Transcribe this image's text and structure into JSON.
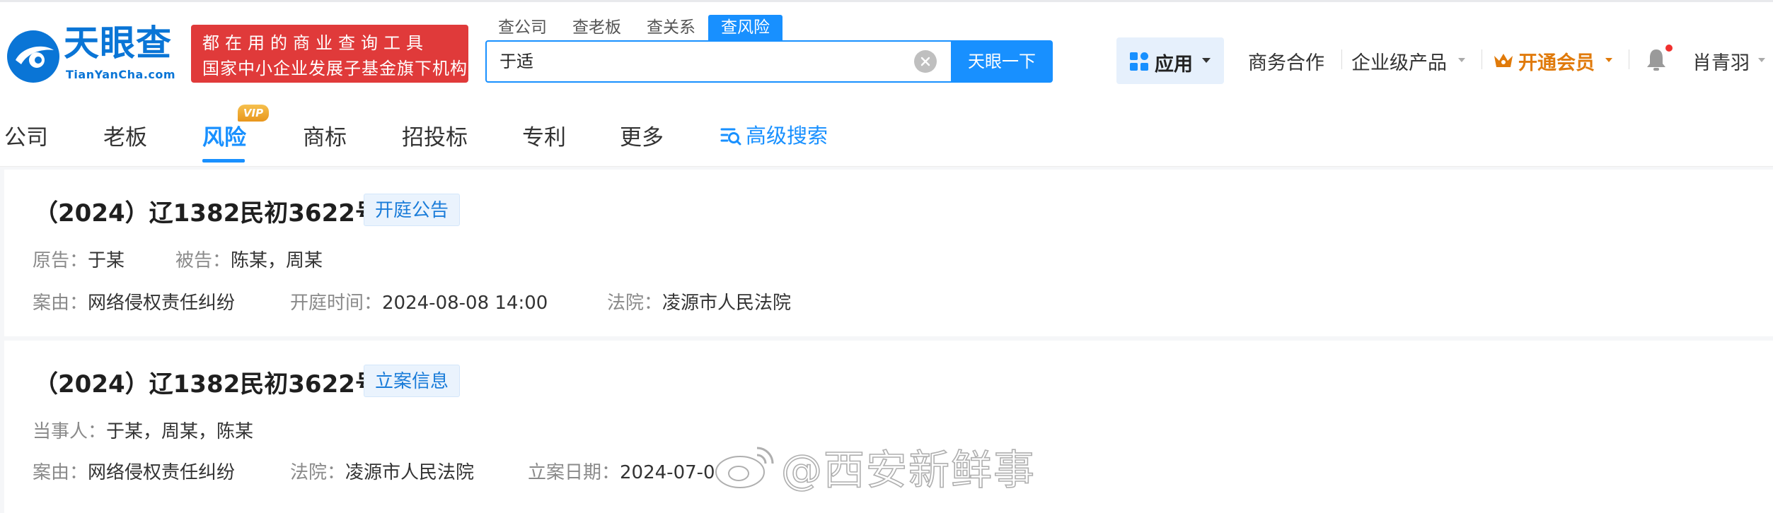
{
  "logo": {
    "cn": "天眼查",
    "en": "TianYanCha.com"
  },
  "slogan": {
    "line1": "都在用的商业查询工具",
    "line2": "国家中小企业发展子基金旗下机构"
  },
  "search": {
    "tabs": [
      "查公司",
      "查老板",
      "查关系",
      "查风险"
    ],
    "active_tab": "查风险",
    "query": "于适",
    "button": "天眼一下"
  },
  "nav": {
    "apps": "应用",
    "business": "商务合作",
    "enterprise": "企业级产品",
    "vip": "开通会员",
    "user": "肖青羽"
  },
  "categories": {
    "items": [
      "公司",
      "老板",
      "风险",
      "商标",
      "招投标",
      "专利",
      "更多"
    ],
    "active": "风险",
    "vip_badge": "VIP",
    "advanced": "高级搜索"
  },
  "cards": [
    {
      "title": "（2024）辽1382民初3622号",
      "tag": "开庭公告",
      "row1": [
        {
          "k": "原告：",
          "v": "于某"
        },
        {
          "k": "被告：",
          "v": "陈某，周某"
        }
      ],
      "row2": [
        {
          "k": "案由：",
          "v": "网络侵权责任纠纷"
        },
        {
          "k": "开庭时间：",
          "v": "2024-08-08 14:00"
        },
        {
          "k": "法院：",
          "v": "凌源市人民法院"
        }
      ]
    },
    {
      "title": "（2024）辽1382民初3622号",
      "tag": "立案信息",
      "row1": [
        {
          "k": "当事人：",
          "v": "于某，周某，陈某"
        }
      ],
      "row2": [
        {
          "k": "案由：",
          "v": "网络侵权责任纠纷"
        },
        {
          "k": "法院：",
          "v": "凌源市人民法院"
        },
        {
          "k": "立案日期：",
          "v": "2024-07-0"
        }
      ]
    }
  ],
  "watermark": "@西安新鲜事",
  "colors": {
    "brand": "#1890ff",
    "logo": "#0a75d6",
    "slogan_bg": "#e03a3a",
    "vip": "#e07a0a"
  }
}
